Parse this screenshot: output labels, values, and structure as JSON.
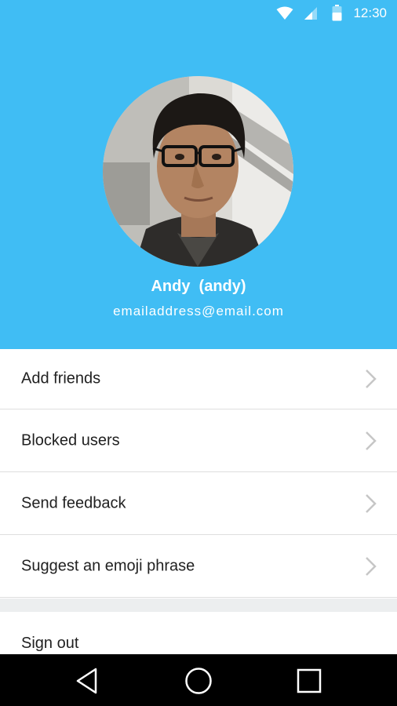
{
  "status_bar": {
    "time": "12:30",
    "icons": [
      "wifi-icon",
      "cell-signal-icon",
      "battery-icon"
    ]
  },
  "profile": {
    "name": "Andy  (andy)",
    "email": "emailaddress@email.com"
  },
  "menu": {
    "items": [
      {
        "label": "Add friends"
      },
      {
        "label": "Blocked users"
      },
      {
        "label": "Send feedback"
      },
      {
        "label": "Suggest an emoji phrase"
      }
    ],
    "sign_out": "Sign out"
  },
  "navigation": {
    "buttons": [
      "back-icon",
      "home-icon",
      "recents-icon"
    ]
  },
  "colors": {
    "header_bg": "#40bdf4",
    "text": "#212121",
    "divider": "#dedede",
    "section_gap": "#eceeef",
    "nav_bar": "#000000"
  }
}
